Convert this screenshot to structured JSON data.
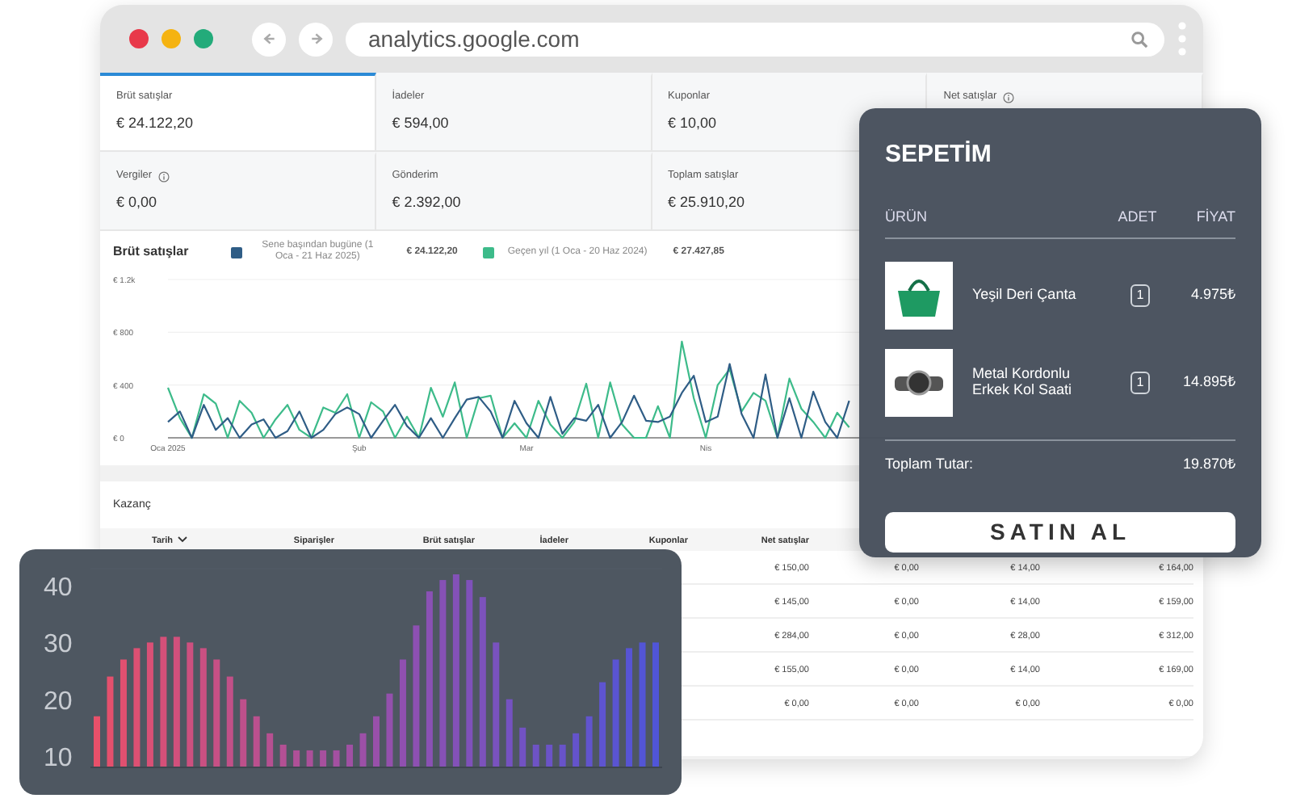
{
  "browser": {
    "url": "analytics.google.com"
  },
  "tiles": [
    {
      "label": "Brüt satışlar",
      "value": "€ 24.122,20",
      "info": false,
      "selected": true
    },
    {
      "label": "İadeler",
      "value": "€ 594,00",
      "info": false,
      "selected": false
    },
    {
      "label": "Kuponlar",
      "value": "€ 10,00",
      "info": false,
      "selected": false
    },
    {
      "label": "Net satışlar",
      "info": true,
      "selected": false
    },
    {
      "label": "Vergiler",
      "value": "€ 0,00",
      "info": true,
      "selected": false
    },
    {
      "label": "Gönderim",
      "value": "€ 2.392,00",
      "info": false,
      "selected": false
    },
    {
      "label": "Toplam satışlar",
      "value": "€ 25.910,20",
      "info": false,
      "selected": false
    }
  ],
  "sales_chart": {
    "legend": [
      {
        "checked": true,
        "total": "€ 24.122,20"
      },
      {
        "checked": true,
        "total": "€ 27.427,85"
      }
    ],
    "chart_data": {
      "type": "line",
      "title": "Brüt satışlar",
      "ylim": [
        0,
        1200
      ],
      "categories": [
        "Oca 2025",
        null,
        null,
        null,
        null,
        null,
        null,
        null,
        null,
        null,
        null,
        null,
        null,
        null,
        null,
        null,
        "Şub",
        null,
        null,
        null,
        null,
        null,
        null,
        null,
        null,
        null,
        null,
        null,
        null,
        null,
        "Mar",
        null,
        null,
        null,
        null,
        null,
        null,
        null,
        null,
        null,
        null,
        null,
        null,
        null,
        null,
        "Nis",
        null,
        null,
        null,
        null,
        null,
        null,
        null,
        null,
        null,
        null,
        null,
        null
      ],
      "yticks": [
        {
          "value": 0,
          "label": "€ 0"
        },
        {
          "value": 400,
          "label": "€ 400"
        },
        {
          "value": 800,
          "label": "€ 800"
        },
        {
          "value": 1200,
          "label": "€ 1.2k"
        }
      ],
      "series": [
        {
          "name": "Sene başından bugüne (1 Oca - 21 Haz 2025)",
          "color": "#2f5d86",
          "values": [
            120,
            200,
            0,
            250,
            60,
            150,
            0,
            100,
            140,
            0,
            50,
            200,
            0,
            60,
            180,
            230,
            180,
            0,
            130,
            250,
            90,
            0,
            150,
            0,
            150,
            290,
            310,
            200,
            0,
            280,
            110,
            0,
            310,
            30,
            150,
            130,
            250,
            0,
            120,
            320,
            130,
            120,
            160,
            340,
            470,
            120,
            160,
            560,
            180,
            0,
            480,
            0,
            300,
            0,
            350,
            120,
            0,
            280
          ]
        },
        {
          "name": "Geçen yıl (1 Oca - 20 Haz 2024)",
          "color": "#3dbb8a",
          "values": [
            380,
            150,
            0,
            330,
            260,
            0,
            280,
            190,
            0,
            140,
            250,
            60,
            0,
            230,
            190,
            330,
            0,
            270,
            200,
            0,
            160,
            0,
            380,
            160,
            420,
            0,
            300,
            320,
            0,
            110,
            0,
            280,
            100,
            0,
            120,
            410,
            0,
            420,
            100,
            0,
            0,
            240,
            0,
            730,
            300,
            0,
            400,
            520,
            200,
            340,
            280,
            0,
            450,
            220,
            120,
            0,
            190,
            80
          ]
        }
      ]
    }
  },
  "earnings": {
    "title": "Kazanç",
    "columns": [
      {
        "label": "Tarih",
        "sorted": true
      },
      {
        "label": "Siparişler",
        "sorted": false
      },
      {
        "label": "Brüt satışlar",
        "sorted": false
      },
      {
        "label": "İadeler",
        "sorted": false
      },
      {
        "label": "Kuponlar",
        "sorted": false
      },
      {
        "label": "Net satışlar",
        "sorted": false
      }
    ],
    "rows": [
      {
        "net_sales": "€ 150,00",
        "column_7": "€ 0,00",
        "column_8": "€ 14,00",
        "column_9": "€ 164,00"
      },
      {
        "net_sales": "€ 145,00",
        "column_7": "€ 0,00",
        "column_8": "€ 14,00",
        "column_9": "€ 159,00"
      },
      {
        "net_sales": "€ 284,00",
        "column_7": "€ 0,00",
        "column_8": "€ 28,00",
        "column_9": "€ 312,00"
      },
      {
        "net_sales": "€ 155,00",
        "column_7": "€ 0,00",
        "column_8": "€ 14,00",
        "column_9": "€ 169,00"
      },
      {
        "net_sales": "€ 0,00",
        "column_7": "€ 0,00",
        "column_8": "€ 0,00",
        "column_9": "€ 0,00"
      }
    ]
  },
  "cart": {
    "title": "SEPETİM",
    "columns": [
      "ÜRÜN",
      "ADET",
      "FİYAT"
    ],
    "items": [
      {
        "name": "Yeşil Deri Çanta",
        "quantity": "1",
        "price": "4.975₺",
        "kind": "bag"
      },
      {
        "name": "Metal Kordonlu Erkek Kol Saati",
        "quantity": "1",
        "price": "14.895₺",
        "kind": "watch"
      }
    ],
    "total_label": "Toplam Tutar:",
    "total": "19.870₺",
    "button": "SATIN AL"
  },
  "bar_panel": {
    "chart_data": {
      "type": "bar",
      "ylim": [
        8,
        43
      ],
      "yticks": [
        {
          "value": 10,
          "label": "10"
        },
        {
          "value": 20,
          "label": "20"
        },
        {
          "value": 30,
          "label": "30"
        },
        {
          "value": 40,
          "label": "40"
        }
      ],
      "categories": [
        null,
        null,
        null,
        null,
        null,
        null,
        null,
        null,
        null,
        null,
        null,
        null,
        null,
        null,
        null,
        null,
        null,
        null,
        null,
        null,
        null,
        null,
        null,
        null,
        null,
        null,
        null,
        null,
        null,
        null,
        null,
        null,
        null,
        null,
        null,
        null,
        null,
        null,
        null,
        null,
        null,
        null,
        null
      ],
      "values": [
        17,
        24,
        27,
        29,
        30,
        31,
        31,
        30,
        29,
        27,
        24,
        20,
        17,
        14,
        12,
        11,
        11,
        11,
        11,
        12,
        14,
        17,
        21,
        27,
        33,
        39,
        41,
        42,
        41,
        38,
        30,
        20,
        15,
        12,
        12,
        12,
        14,
        17,
        23,
        27,
        29,
        30,
        30
      ]
    }
  }
}
